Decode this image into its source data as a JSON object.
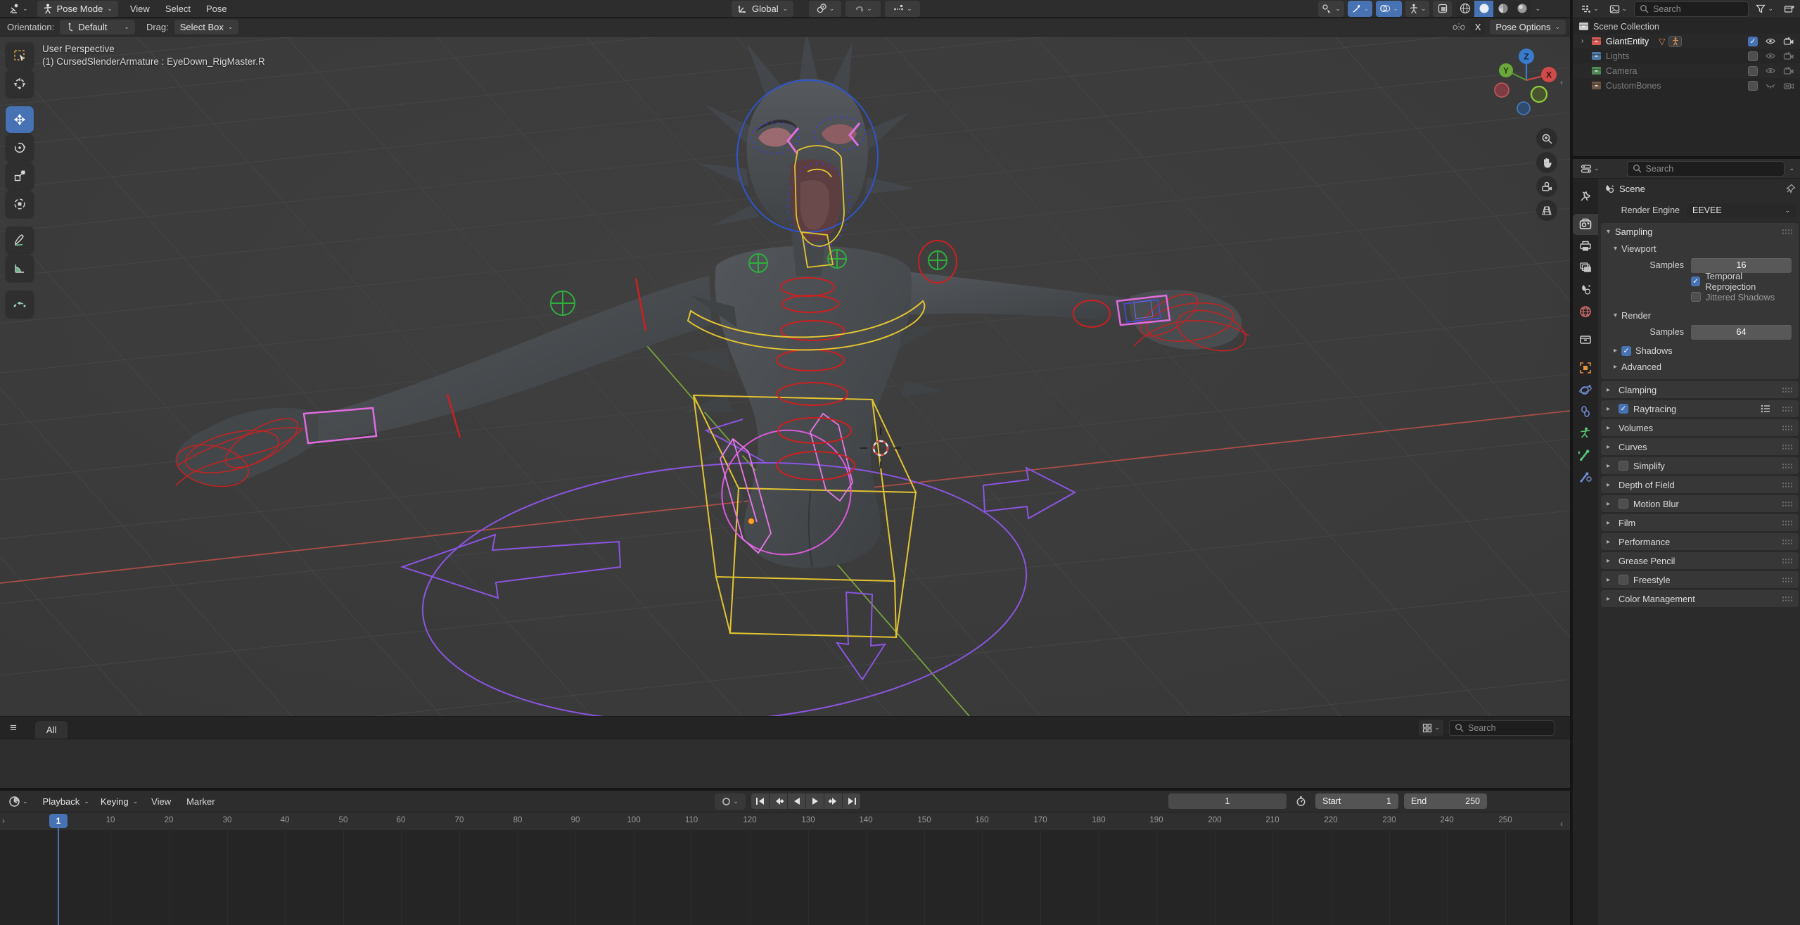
{
  "icons": {
    "chevron": "⌄",
    "caret_right": "▸",
    "caret_down": "▾",
    "check": "✓",
    "hamburger": "≡",
    "collapse_left": "‹",
    "region_arrow": "›",
    "mesh_data_badge": "▽"
  },
  "viewport_header": {
    "mode": "Pose Mode",
    "menus": [
      "View",
      "Select",
      "Pose"
    ],
    "transform_orientation": "Global",
    "tool_settings": {
      "orientation_label": "Orientation:",
      "orientation_value": "Default",
      "drag_label": "Drag:",
      "drag_value": "Select Box",
      "mirror_x": "X",
      "pose_options": "Pose Options"
    }
  },
  "viewport": {
    "perspective_label": "User Perspective",
    "active_object_label": "(1) CursedSlenderArmature : EyeDown_RigMaster.R",
    "axis_labels": {
      "x": "X",
      "y": "Y",
      "z": "Z"
    }
  },
  "toolbar": {
    "tools": [
      {
        "name": "select-box"
      },
      {
        "name": "cursor"
      },
      {
        "name": "move",
        "active": true
      },
      {
        "name": "rotate"
      },
      {
        "name": "scale"
      },
      {
        "name": "transform"
      },
      {
        "name": "annotate"
      },
      {
        "name": "measure"
      },
      {
        "name": "pose-breakdowner"
      }
    ]
  },
  "shading_modes": [
    {
      "name": "wireframe"
    },
    {
      "name": "solid",
      "active": true
    },
    {
      "name": "material-preview"
    },
    {
      "name": "rendered"
    }
  ],
  "asset_shelf": {
    "active_tab": "All",
    "search_placeholder": "Search"
  },
  "outliner": {
    "search_placeholder": "Search",
    "rows": [
      {
        "label": "Scene Collection",
        "icon_color": "#c9c9c9",
        "level": 0
      },
      {
        "label": "GiantEntity",
        "icon_color": "#d65a52",
        "level": 1,
        "expand": true,
        "badges": true,
        "checkbox": "on",
        "eye": "open",
        "camera": "on",
        "bright": true
      },
      {
        "label": "Lights",
        "icon_color": "#4f7ba6",
        "level": 1,
        "dim": true,
        "checkbox": "off",
        "eye": "open",
        "camera": "on"
      },
      {
        "label": "Camera",
        "icon_color": "#4f8a52",
        "level": 1,
        "dim": true,
        "checkbox": "off",
        "eye": "open",
        "camera": "on"
      },
      {
        "label": "CustomBones",
        "icon_color": "#6e5745",
        "level": 1,
        "dim": true,
        "checkbox": "off",
        "eye": "closed",
        "camera": "off"
      }
    ]
  },
  "properties": {
    "search_placeholder": "Search",
    "breadcrumb": "Scene",
    "render_engine_label": "Render Engine",
    "render_engine_value": "EEVEE",
    "sampling": {
      "title": "Sampling",
      "viewport_title": "Viewport",
      "viewport_samples_label": "Samples",
      "viewport_samples_value": "16",
      "temporal_label": "Temporal Reprojection",
      "temporal_checked": true,
      "jittered_label": "Jittered Shadows",
      "jittered_checked": false,
      "render_title": "Render",
      "render_samples_label": "Samples",
      "render_samples_value": "64",
      "shadows_label": "Shadows",
      "shadows_checked": true,
      "advanced_label": "Advanced"
    },
    "panels": [
      {
        "label": "Clamping"
      },
      {
        "label": "Raytracing",
        "checkbox": "on",
        "list_icon": true
      },
      {
        "label": "Volumes"
      },
      {
        "label": "Curves"
      },
      {
        "label": "Simplify",
        "checkbox": "off"
      },
      {
        "label": "Depth of Field"
      },
      {
        "label": "Motion Blur",
        "checkbox": "off"
      },
      {
        "label": "Film"
      },
      {
        "label": "Performance"
      },
      {
        "label": "Grease Pencil"
      },
      {
        "label": "Freestyle",
        "checkbox": "off"
      },
      {
        "label": "Color Management"
      }
    ],
    "tabs": [
      {
        "name": "tool",
        "color": "#c9c9c9"
      },
      {
        "name": "render",
        "color": "#e0e0e0",
        "active": true
      },
      {
        "name": "output",
        "color": "#c9c9c9"
      },
      {
        "name": "view-layer",
        "color": "#c9c9c9"
      },
      {
        "name": "scene",
        "color": "#c9c9c9"
      },
      {
        "name": "world",
        "color": "#d66d6d"
      },
      {
        "name": "collection",
        "color": "#c9c9c9"
      },
      {
        "name": "object",
        "color": "#e8923c"
      },
      {
        "name": "physics",
        "color": "#7390d8"
      },
      {
        "name": "constraints",
        "color": "#7390d8"
      },
      {
        "name": "object-data",
        "color": "#58c97a"
      },
      {
        "name": "bone",
        "color": "#58c97a"
      },
      {
        "name": "bone-constraint",
        "color": "#7390d8"
      }
    ]
  },
  "timeline": {
    "menus": [
      "Playback",
      "Keying",
      "View",
      "Marker"
    ],
    "current_frame": "1",
    "start_label": "Start",
    "start_value": "1",
    "end_label": "End",
    "end_value": "250",
    "ticks": [
      "1",
      "10",
      "20",
      "30",
      "40",
      "50",
      "60",
      "70",
      "80",
      "90",
      "100",
      "110",
      "120",
      "130",
      "140",
      "150",
      "160",
      "170",
      "180",
      "190",
      "200",
      "210",
      "220",
      "230",
      "240",
      "250"
    ]
  },
  "colors": {
    "accent": "#4772b3",
    "axis_x": "#b14d49",
    "axis_y": "#7ba83c",
    "bone_red": "#cc2020",
    "bone_yellow": "#e3c431",
    "bone_purple": "#8a55e0",
    "bone_magenta": "#da5ada",
    "bone_blue": "#3c3cd4",
    "bone_green": "#2fae3e"
  }
}
